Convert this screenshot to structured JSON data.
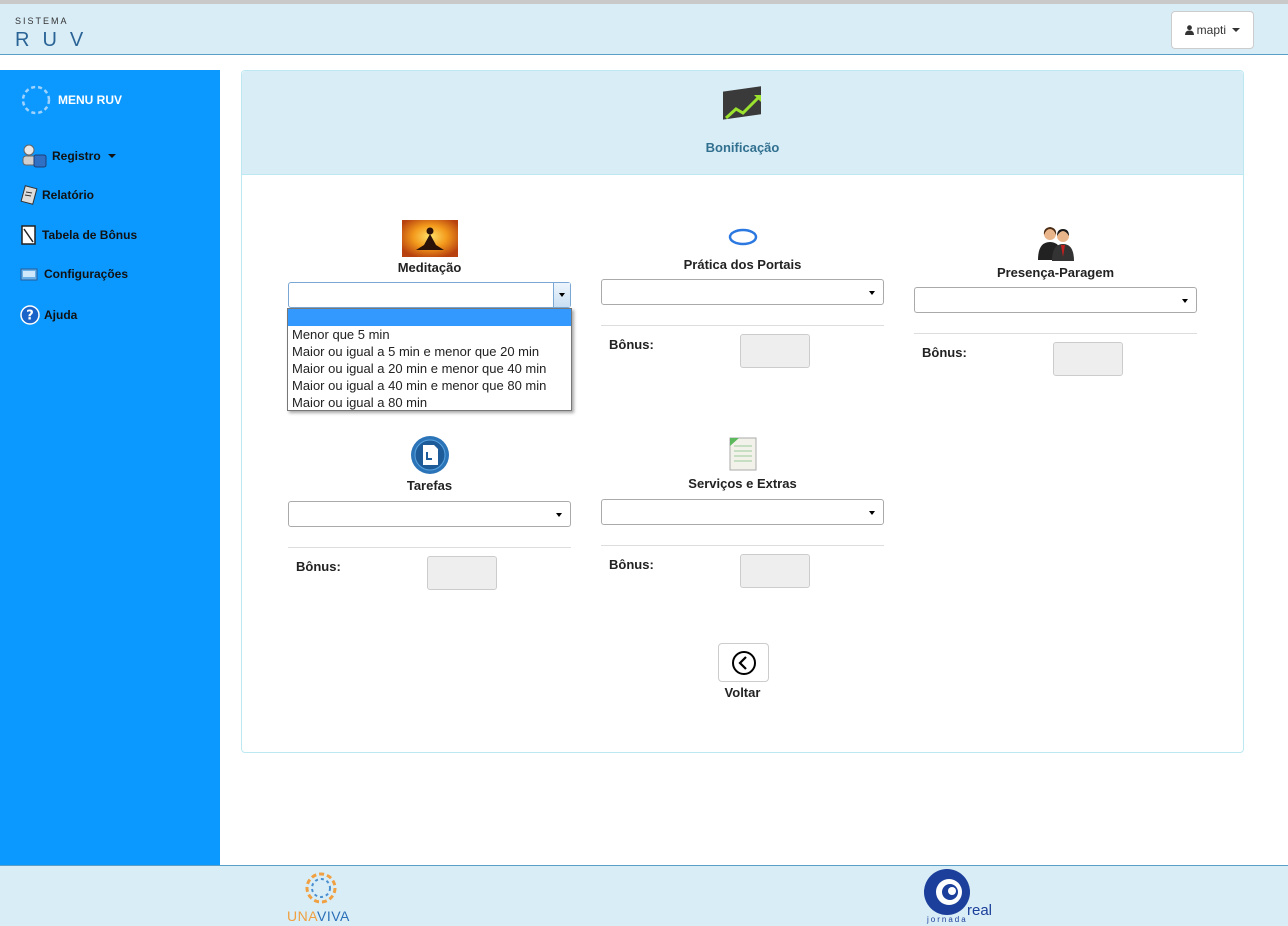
{
  "header": {
    "brand_small": "SISTEMA",
    "brand_big": "RUV",
    "user_label": "mapti"
  },
  "sidebar": {
    "menu_title": "MENU RUV",
    "items": [
      {
        "label": "Registro",
        "icon": "user-register-icon",
        "has_caret": true
      },
      {
        "label": "Relatório",
        "icon": "report-icon"
      },
      {
        "label": "Tabela de Bônus",
        "icon": "table-icon"
      },
      {
        "label": "Configurações",
        "icon": "settings-icon"
      },
      {
        "label": "Ajuda",
        "icon": "help-icon"
      }
    ]
  },
  "panel": {
    "title": "Bonificação",
    "title_icon": "growth-chart-icon",
    "bonus_label": "Bônus:",
    "sections": [
      {
        "title": "Meditação",
        "icon": "meditation-icon",
        "value": "",
        "dropdown_open": true
      },
      {
        "title": "Prática dos Portais",
        "icon": "portal-ring-icon",
        "value": ""
      },
      {
        "title": "Presença-Paragem",
        "icon": "people-icon",
        "value": ""
      },
      {
        "title": "Tarefas",
        "icon": "tasks-document-icon",
        "value": ""
      },
      {
        "title": "Serviços e Extras",
        "icon": "notes-icon",
        "value": ""
      }
    ],
    "meditation_options": [
      "",
      "Menor que 5 min",
      "Maior ou igual a 5 min e menor que 20 min",
      "Maior ou igual a 20 min e menor que 40 min",
      "Maior ou igual a 40 min e menor que 80 min",
      "Maior ou igual a 80 min"
    ],
    "back_label": "Voltar"
  },
  "footer": {
    "logo_left_a": "UNA",
    "logo_left_b": "VIVA",
    "logo_right": "real",
    "logo_right_sub": "jornada"
  },
  "colors": {
    "sidebar": "#0b98ff",
    "header_bg": "#d9edf7",
    "panel_title": "#31708f",
    "selected_option": "#3399ff"
  }
}
